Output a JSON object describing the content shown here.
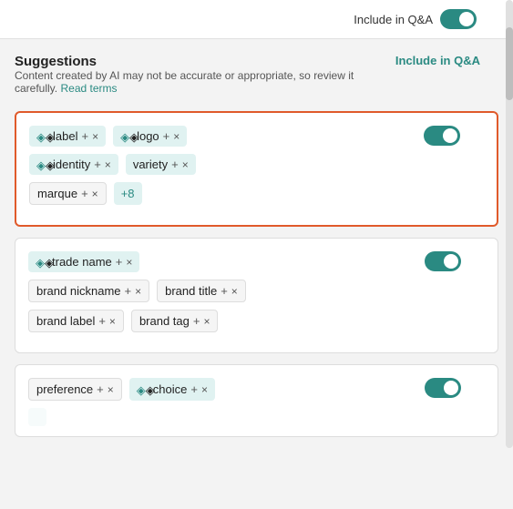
{
  "topbar": {
    "toggle_label": "Include in Q&A",
    "toggle_on": true
  },
  "suggestions": {
    "title": "Suggestions",
    "subtitle": "Content created by AI may not be accurate or appropriate, so review it carefully.",
    "read_terms": "Read terms",
    "column_label": "Include in Q&A"
  },
  "cards": [
    {
      "id": "card1",
      "selected": true,
      "toggle_on": true,
      "tags": [
        {
          "text": "label",
          "ai": true,
          "type": "teal"
        },
        {
          "text": "logo",
          "ai": true,
          "type": "teal"
        },
        {
          "text": "identity",
          "ai": true,
          "type": "teal"
        },
        {
          "text": "variety",
          "ai": false,
          "type": "teal"
        },
        {
          "text": "marque",
          "ai": false,
          "type": "plain"
        }
      ],
      "more": "+8"
    },
    {
      "id": "card2",
      "selected": false,
      "toggle_on": true,
      "tags": [
        {
          "text": "trade name",
          "ai": true,
          "type": "teal"
        },
        {
          "text": "brand nickname",
          "ai": false,
          "type": "plain"
        },
        {
          "text": "brand title",
          "ai": false,
          "type": "plain"
        },
        {
          "text": "brand label",
          "ai": false,
          "type": "plain"
        },
        {
          "text": "brand tag",
          "ai": false,
          "type": "plain"
        }
      ],
      "more": null
    },
    {
      "id": "card3",
      "selected": false,
      "toggle_on": true,
      "tags": [
        {
          "text": "preference",
          "ai": false,
          "type": "plain"
        },
        {
          "text": "choice",
          "ai": true,
          "type": "teal"
        }
      ],
      "more": null,
      "partial": true
    }
  ],
  "icons": {
    "sparkle": "◈",
    "plus": "+",
    "close": "×",
    "toggle_on_color": "#2a8a82"
  }
}
